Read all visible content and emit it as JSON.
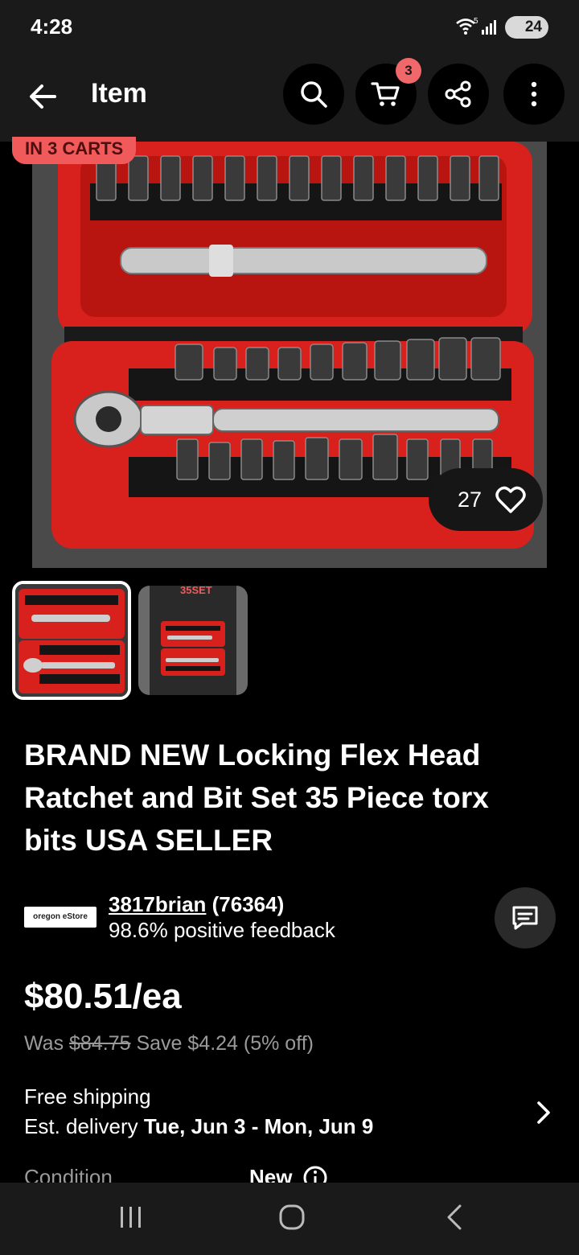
{
  "status_bar": {
    "time": "4:28",
    "wifi_badge": "5",
    "battery": "24"
  },
  "app_bar": {
    "title": "Item",
    "cart_count": "3"
  },
  "listing": {
    "carts_badge": "IN 3 CARTS",
    "like_count": "27",
    "title": "BRAND NEW Locking Flex Head Ratchet and Bit Set 35 Piece torx bits USA SELLER",
    "thumb_box_label": "35SET"
  },
  "seller": {
    "logo_text": "oregon eStore",
    "username": "3817brian",
    "score": "(76364)",
    "feedback": "98.6% positive feedback"
  },
  "pricing": {
    "price": "$80.51/ea",
    "was_label": "Was",
    "was_price": "$84.75",
    "save_text": "Save $4.24 (5% off)"
  },
  "shipping": {
    "shipping_text": "Free shipping",
    "delivery_label": "Est. delivery",
    "delivery_dates": "Tue, Jun 3 - Mon, Jun 9"
  },
  "condition": {
    "label": "Condition",
    "value": "New"
  },
  "icons": {
    "back": "arrow-left-icon",
    "search": "search-icon",
    "cart": "cart-icon",
    "share": "share-icon",
    "more": "more-vert-icon",
    "heart": "heart-icon",
    "message": "message-icon",
    "chevron": "chevron-right-icon",
    "info": "info-icon"
  },
  "colors": {
    "badge_red": "#f0686a",
    "carts_pill": "#f05a5a",
    "case_red": "#d8211c"
  }
}
